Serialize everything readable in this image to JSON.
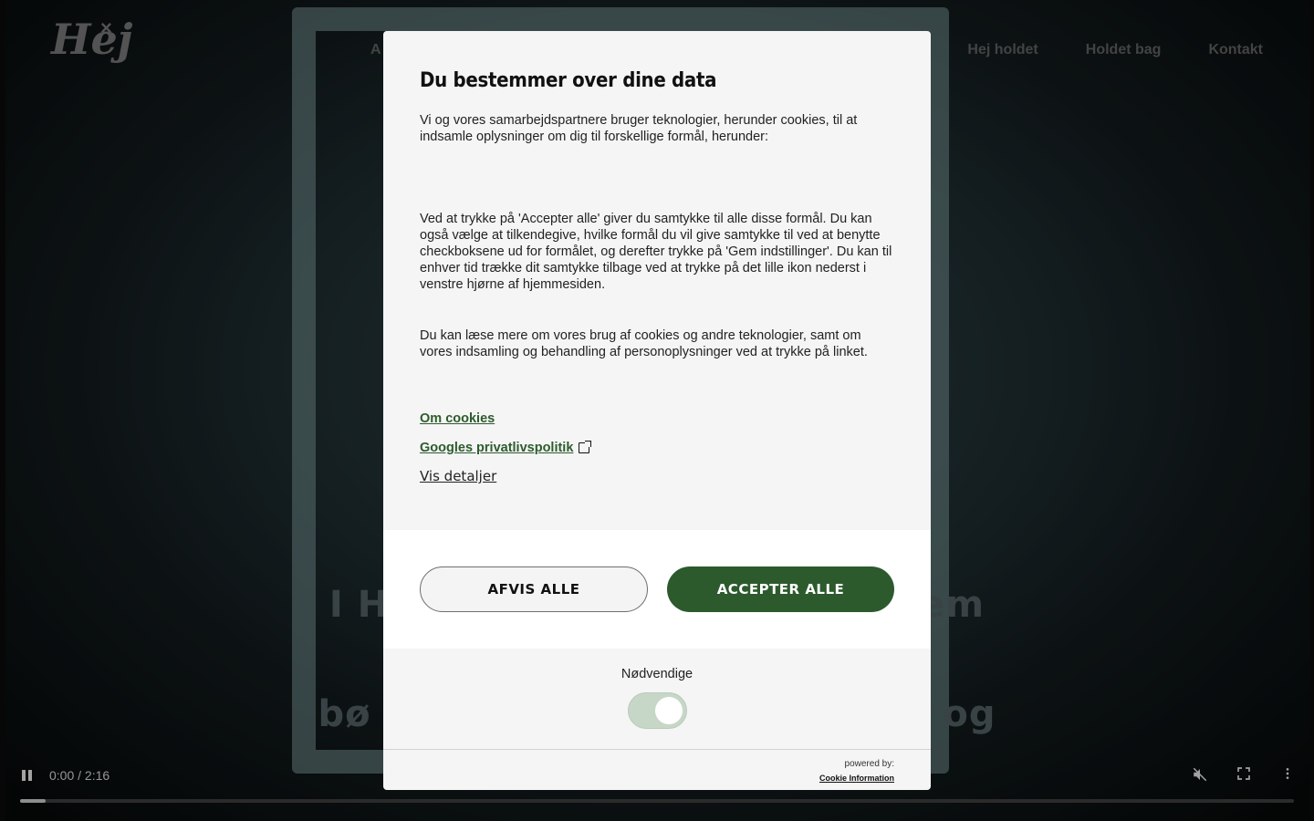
{
  "nav": {
    "left_partial": "A",
    "items": [
      "Hej holdet",
      "Holdet bag",
      "Kontakt"
    ]
  },
  "logo": {
    "text": "Hej",
    "mark": "×"
  },
  "hero": {
    "line1": "I H                                       em",
    "line2": "bø                                          og"
  },
  "video": {
    "time": "0:00 / 2:16",
    "progress_fraction": 0.02,
    "icons": [
      "pause-icon",
      "mute-icon",
      "fullscreen-icon",
      "more-vert-icon"
    ]
  },
  "dialog": {
    "title": "Du bestemmer over dine data",
    "p1": "Vi og vores samarbejdspartnere bruger teknologier, herunder cookies, til at indsamle oplysninger om dig til forskellige formål, herunder:",
    "p2": "Ved at trykke på 'Accepter alle' giver du samtykke til alle disse formål. Du kan også vælge at tilkendegive, hvilke formål du vil give samtykke til ved at benytte checkboksene ud for formålet, og derefter trykke på 'Gem indstillinger'. Du kan til enhver tid trække dit samtykke tilbage ved at trykke på det lille ikon nederst i venstre hjørne af hjemmesiden.",
    "p3": "Du kan læse mere om vores brug af cookies og andre teknologier, samt om vores indsamling og behandling af personoplysninger ved at trykke på linket.",
    "link_cookies": "Om cookies",
    "link_google": "Googles privatlivspolitik",
    "vis_detaljer": "Vis detaljer",
    "btn_reject": "AFVIS ALLE",
    "btn_accept": "ACCEPTER ALLE",
    "necessary_label": "Nødvendige",
    "necessary_on": true,
    "powered_by": "powered by:",
    "powered_link": "Cookie Information"
  },
  "colors": {
    "accent_green": "#2c5a2d",
    "link_green": "#2d5b2d",
    "toggle_bg": "#c7d7c7"
  }
}
